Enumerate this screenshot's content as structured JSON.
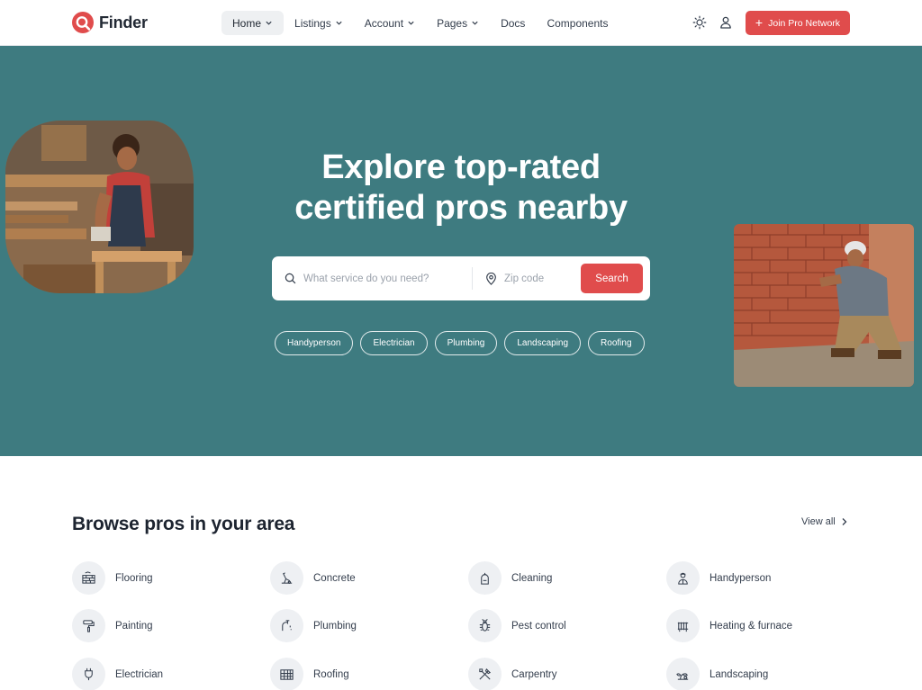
{
  "brand": {
    "name": "Finder",
    "accent": "#e04c4c",
    "hero_bg": "#3e7b80"
  },
  "nav": [
    {
      "label": "Home",
      "dropdown": true,
      "active": true
    },
    {
      "label": "Listings",
      "dropdown": true
    },
    {
      "label": "Account",
      "dropdown": true
    },
    {
      "label": "Pages",
      "dropdown": true
    },
    {
      "label": "Docs",
      "dropdown": false
    },
    {
      "label": "Components",
      "dropdown": false
    }
  ],
  "header": {
    "theme_icon": "sun-icon",
    "account_icon": "user-icon",
    "cta_label": "Join Pro Network"
  },
  "hero": {
    "title_line1": "Explore top-rated",
    "title_line2": "certified pros nearby",
    "service_placeholder": "What service do you need?",
    "zip_placeholder": "Zip code",
    "search_label": "Search",
    "chips": [
      "Handyperson",
      "Electrician",
      "Plumbing",
      "Landscaping",
      "Roofing"
    ]
  },
  "browse": {
    "title": "Browse pros in your area",
    "view_all": "View all",
    "categories": [
      {
        "label": "Flooring",
        "icon": "flooring-icon"
      },
      {
        "label": "Concrete",
        "icon": "concrete-icon"
      },
      {
        "label": "Cleaning",
        "icon": "cleaning-icon"
      },
      {
        "label": "Handyperson",
        "icon": "handyperson-icon"
      },
      {
        "label": "Painting",
        "icon": "paint-roller-icon"
      },
      {
        "label": "Plumbing",
        "icon": "faucet-icon"
      },
      {
        "label": "Pest control",
        "icon": "bug-icon"
      },
      {
        "label": "Heating & furnace",
        "icon": "radiator-icon"
      },
      {
        "label": "Electrician",
        "icon": "plug-icon"
      },
      {
        "label": "Roofing",
        "icon": "roof-tiles-icon"
      },
      {
        "label": "Carpentry",
        "icon": "tools-icon"
      },
      {
        "label": "Landscaping",
        "icon": "landscaping-icon"
      }
    ]
  }
}
